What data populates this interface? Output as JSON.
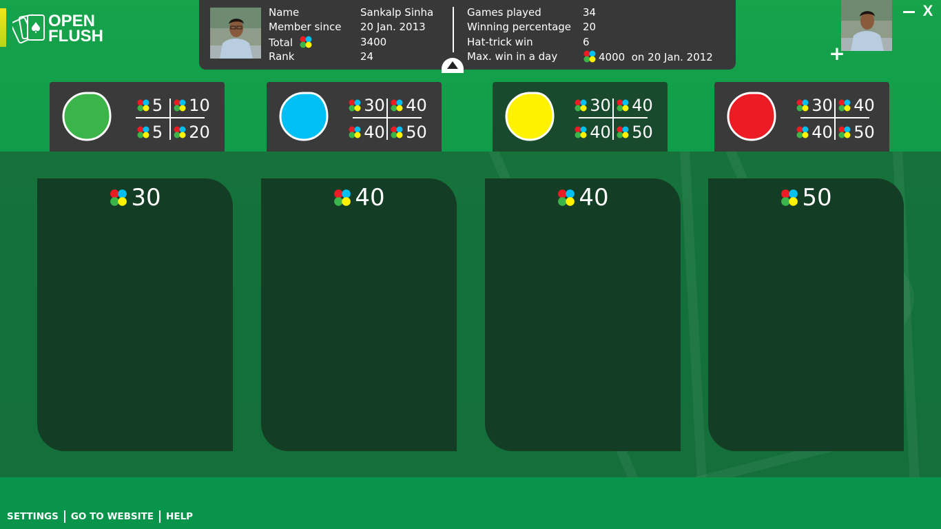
{
  "app": {
    "logo_line1": "OPEN",
    "logo_line2": "FLUSH"
  },
  "profile": {
    "labels_left": [
      "Name",
      "Member since",
      "Total",
      "Rank"
    ],
    "values_left": [
      "Sankalp Sinha",
      "20 Jan. 2013",
      "3400",
      "24"
    ],
    "labels_right": [
      "Games played",
      "Winning percentage",
      "Hat-trick win",
      "Max. win in a day"
    ],
    "values_right": [
      "34",
      "20",
      "6",
      "4000  on 20 Jan. 2012"
    ],
    "avatar_icon": "user-photo",
    "toggle_icon": "collapse-up-icon"
  },
  "window": {
    "add_label": "+",
    "close_label": "X"
  },
  "colors": {
    "green": "#3bb54a",
    "blue": "#00bff3",
    "yellow": "#fff200",
    "red": "#ed1c24",
    "card": "#3a3a3a",
    "table": "#143d25"
  },
  "rooms": [
    {
      "color": "green",
      "stakes": [
        "5",
        "10",
        "5",
        "20"
      ]
    },
    {
      "color": "blue",
      "stakes": [
        "30",
        "40",
        "40",
        "50"
      ]
    },
    {
      "color": "yellow",
      "stakes": [
        "30",
        "40",
        "40",
        "50"
      ]
    },
    {
      "color": "red",
      "stakes": [
        "30",
        "40",
        "40",
        "50"
      ]
    }
  ],
  "tables": [
    {
      "stake": "30"
    },
    {
      "stake": "40"
    },
    {
      "stake": "40"
    },
    {
      "stake": "50"
    }
  ],
  "footer": {
    "settings": "SETTINGS",
    "website": "GO TO WEBSITE",
    "help": "HELP"
  }
}
